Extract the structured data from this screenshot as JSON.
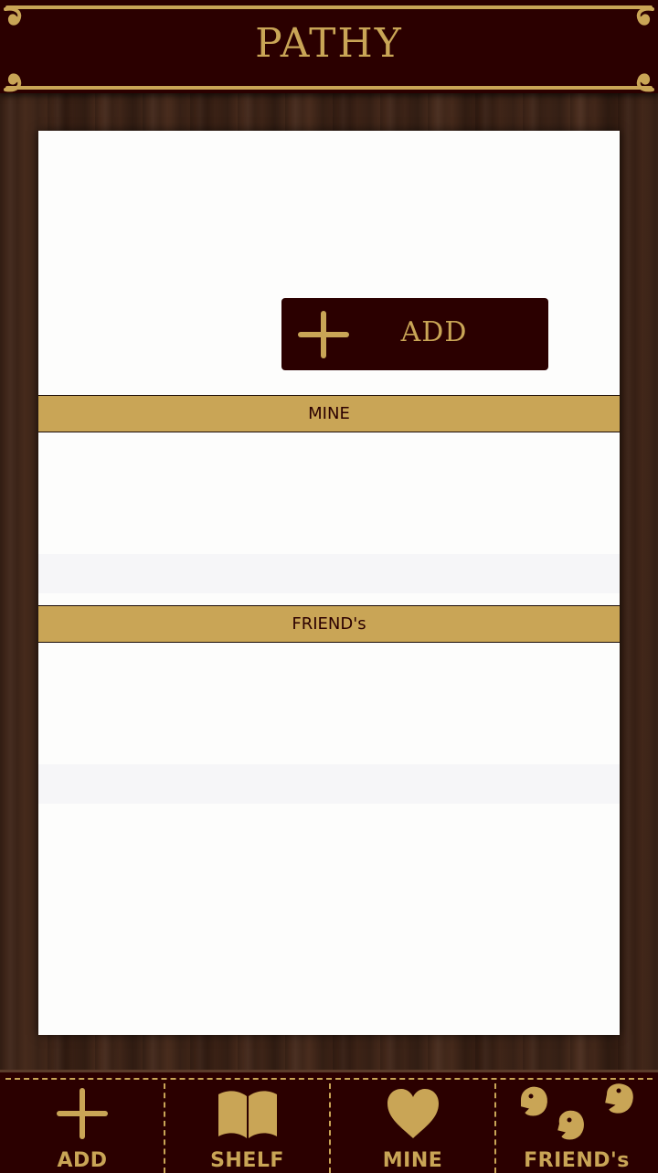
{
  "header": {
    "title": "PATHY"
  },
  "panel": {
    "add_button": {
      "label": "ADD"
    },
    "sections": [
      {
        "label": "MINE"
      },
      {
        "label": "FRIEND's"
      }
    ]
  },
  "bottom_nav": {
    "tabs": [
      {
        "label": "ADD",
        "icon": "plus-icon"
      },
      {
        "label": "SHELF",
        "icon": "book-icon"
      },
      {
        "label": "MINE",
        "icon": "heart-icon"
      },
      {
        "label": "FRIEND's",
        "icon": "friends-icon"
      }
    ]
  },
  "colors": {
    "maroon": "#2b0000",
    "gold": "#c9a556",
    "wood": "#3d2418",
    "panel": "#fdfdfc"
  }
}
